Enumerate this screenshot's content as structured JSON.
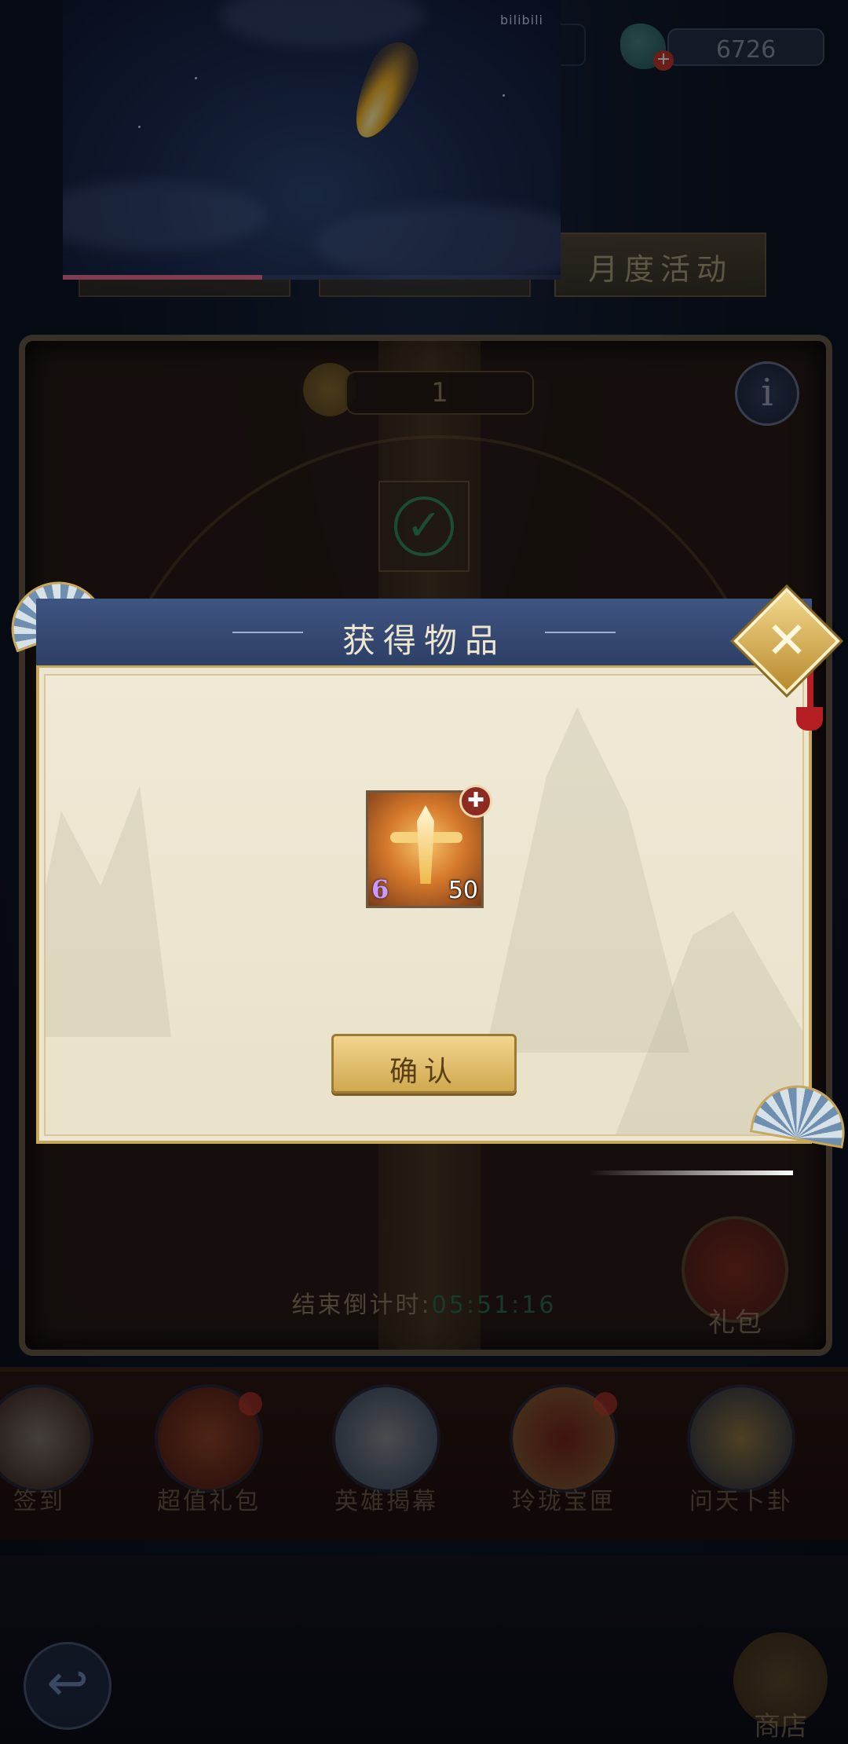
{
  "video": {
    "logo": "bilibili",
    "progress_fraction": 0.4
  },
  "currency": {
    "value": "6726",
    "plus": "+"
  },
  "tabs": {
    "monthly_event": "月度活动"
  },
  "panel": {
    "counter": "1",
    "info": "i",
    "check": "✓",
    "countdown_label": "结束倒计时:",
    "countdown_time": "05:51:16",
    "gift_label": "礼包"
  },
  "nav": {
    "items": [
      {
        "label": "签到",
        "icon": "sign-in-icon"
      },
      {
        "label": "超值礼包",
        "icon": "gift-bag-icon"
      },
      {
        "label": "英雄揭幕",
        "icon": "lotus-icon"
      },
      {
        "label": "玲珑宝匣",
        "icon": "treasure-box-icon"
      },
      {
        "label": "问天卜卦",
        "icon": "divination-icon"
      }
    ],
    "shop_label": "商店",
    "back": "↩"
  },
  "dialog": {
    "title": "获得物品",
    "close": "✕",
    "item": {
      "level": "6",
      "quantity": "50",
      "badge": "✚"
    },
    "confirm_label": "确认"
  },
  "colors": {
    "dialog_header": "#2c3f66",
    "dialog_border": "#c8a85c",
    "confirm_gold": "#d0a94f",
    "progress_pink": "#e86d96"
  }
}
